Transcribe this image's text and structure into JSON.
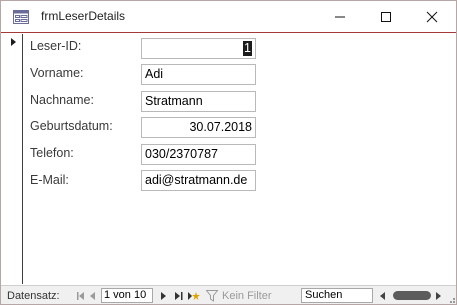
{
  "window": {
    "title": "frmLeserDetails"
  },
  "form": {
    "fields": [
      {
        "label": "Leser-ID:",
        "value": "1"
      },
      {
        "label": "Vorname:",
        "value": "Adi"
      },
      {
        "label": "Nachname:",
        "value": "Stratmann"
      },
      {
        "label": "Geburtsdatum:",
        "value": "30.07.2018"
      },
      {
        "label": "Telefon:",
        "value": "030/2370787"
      },
      {
        "label": "E-Mail:",
        "value": "adi@stratmann.de"
      }
    ]
  },
  "navbar": {
    "label": "Datensatz:",
    "position": "1 von 10",
    "filter_label": "Kein Filter",
    "search_placeholder": "Suchen"
  },
  "icons": {
    "first": "first-record-icon",
    "prev": "previous-record-icon",
    "next": "next-record-icon",
    "last": "last-record-icon",
    "new": "new-record-icon",
    "filter": "filter-icon"
  }
}
